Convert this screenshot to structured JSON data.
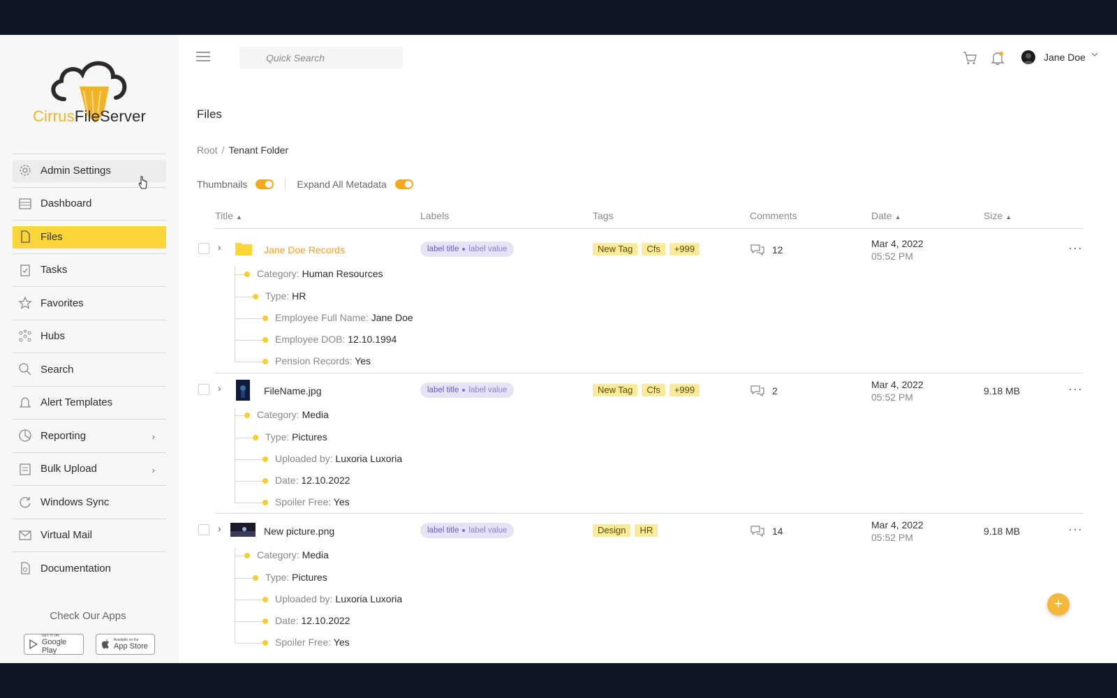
{
  "brand": {
    "name_part1": "Cirrus",
    "name_part2": "FileServer"
  },
  "sidebar": {
    "items": [
      {
        "label": "Admin Settings",
        "icon": "gear-icon",
        "state": "hover"
      },
      {
        "label": "Dashboard",
        "icon": "dashboard-icon"
      },
      {
        "label": "Files",
        "icon": "file-icon",
        "state": "active"
      },
      {
        "label": "Tasks",
        "icon": "clipboard-icon"
      },
      {
        "label": "Favorites",
        "icon": "star-icon"
      },
      {
        "label": "Hubs",
        "icon": "hubs-icon"
      },
      {
        "label": "Search",
        "icon": "search-icon"
      },
      {
        "label": "Alert Templates",
        "icon": "bell-icon"
      },
      {
        "label": "Reporting",
        "icon": "chart-icon",
        "has_submenu": true
      },
      {
        "label": "Bulk Upload",
        "icon": "upload-icon",
        "has_submenu": true
      },
      {
        "label": "Windows Sync",
        "icon": "sync-icon"
      },
      {
        "label": "Virtual Mail",
        "icon": "mail-icon"
      },
      {
        "label": "Documentation",
        "icon": "documentation-icon"
      }
    ],
    "apps_title": "Check Our Apps",
    "google_play": {
      "small": "GET IT ON",
      "big": "Google Play"
    },
    "app_store": {
      "small": "Available on the",
      "big": "App Store"
    }
  },
  "topbar": {
    "search_placeholder": "Quick Search",
    "user_name": "Jane Doe"
  },
  "page": {
    "title": "Files",
    "breadcrumb": {
      "root": "Root",
      "separator": "/",
      "current": "Tenant Folder"
    },
    "toggles": {
      "thumbnails": "Thumbnails",
      "expand_all": "Expand All Metadata"
    }
  },
  "table": {
    "headers": {
      "title": "Title",
      "labels": "Labels",
      "tags": "Tags",
      "comments": "Comments",
      "date": "Date",
      "size": "Size"
    },
    "rows": [
      {
        "name": "Jane Doe Records",
        "type": "folder",
        "label_title": "label title",
        "label_value": "label value",
        "tags": [
          "New Tag",
          "Cfs",
          "+999"
        ],
        "comments": "12",
        "date": "Mar 4, 2022",
        "time": "05:52 PM",
        "size": "",
        "meta": [
          {
            "key": "Category",
            "sep": ": ",
            "value": "Human Resources"
          },
          {
            "key": "Type",
            "sep": ": ",
            "value": "HR"
          },
          {
            "key": "Employee Full Name",
            "sep": ": ",
            "value": "Jane Doe"
          },
          {
            "key": "Employee DOB",
            "sep": ": ",
            "value": "12.10.1994"
          },
          {
            "key": "Pension Records",
            "sep": ": ",
            "value": "Yes"
          }
        ]
      },
      {
        "name": "FileName.jpg",
        "type": "image",
        "label_title": "label title",
        "label_value": "label value",
        "tags": [
          "New Tag",
          "Cfs",
          "+999"
        ],
        "comments": "2",
        "date": "Mar 4, 2022",
        "time": "05:52 PM",
        "size": "9.18 MB",
        "meta": [
          {
            "key": "Category",
            "sep": ": ",
            "value": "Media"
          },
          {
            "key": "Type",
            "sep": ": ",
            "value": "Pictures"
          },
          {
            "key": "Uploaded by",
            "sep": ": ",
            "value": "Luxoria Luxoria"
          },
          {
            "key": "Date",
            "sep": ": ",
            "value": "12.10.2022"
          },
          {
            "key": "Spoiler Free",
            "sep": ": ",
            "value": "Yes"
          }
        ]
      },
      {
        "name": "New picture.png",
        "type": "image",
        "label_title": "label title",
        "label_value": "label value",
        "tags": [
          "Design",
          "HR"
        ],
        "comments": "14",
        "date": "Mar 4, 2022",
        "time": "05:52 PM",
        "size": "9.18 MB",
        "meta": [
          {
            "key": "Category",
            "sep": ": ",
            "value": "Media"
          },
          {
            "key": "Type",
            "sep": ": ",
            "value": "Pictures"
          },
          {
            "key": "Uploaded by",
            "sep": ": ",
            "value": "Luxoria Luxoria"
          },
          {
            "key": "Date",
            "sep": ": ",
            "value": "12.10.2022"
          },
          {
            "key": "Spoiler Free",
            "sep": ": ",
            "value": "Yes"
          }
        ]
      }
    ]
  },
  "colors": {
    "accent": "#fcd638",
    "orange": "#f5a81a",
    "label_bg": "#e6e3f7",
    "tag_bg": "#fde99a"
  }
}
